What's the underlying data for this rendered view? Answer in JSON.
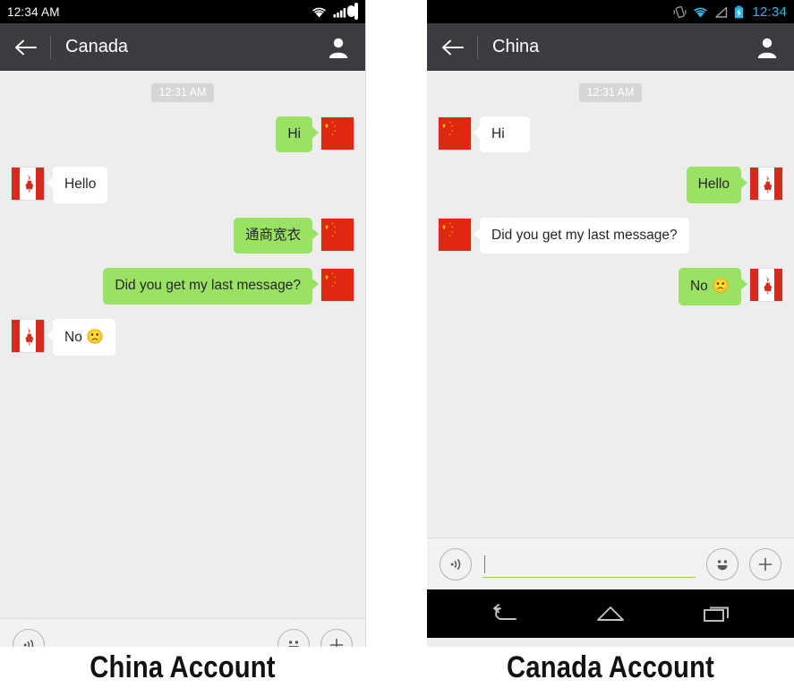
{
  "phones": [
    {
      "id": "china-account",
      "caption": "China Account",
      "statusbar": {
        "clock": "12:34 AM",
        "icons": [
          "wifi-icon",
          "signal-icon",
          "battery-icon"
        ]
      },
      "appbar": {
        "back_label": "back-arrow",
        "title": "Canada",
        "contact_label": "contact-profile"
      },
      "chat": {
        "timestamp": "12:31 AM",
        "messages": [
          {
            "side": "out",
            "text": "Hi",
            "flag": "cn"
          },
          {
            "side": "in",
            "text": "Hello",
            "flag": "ca"
          },
          {
            "side": "out",
            "text": "通商宽衣",
            "flag": "cn"
          },
          {
            "side": "out",
            "text": "Did you get my last message?",
            "flag": "cn"
          },
          {
            "side": "in",
            "text": "No ",
            "emoji": "🙁",
            "flag": "ca"
          }
        ]
      },
      "inputbar": {
        "voice_label": "voice-input",
        "value": "",
        "placeholder": "",
        "focused": false,
        "emoji_label": "emoji-picker",
        "plus_label": "more-options"
      },
      "navbar": null
    },
    {
      "id": "canada-account",
      "caption": "Canada Account",
      "statusbar": {
        "clock": "12:34",
        "icons": [
          "vibrate-icon",
          "wifi-icon",
          "signal-icon",
          "battery-charging-icon"
        ]
      },
      "appbar": {
        "back_label": "back-arrow",
        "title": "China",
        "contact_label": "contact-profile"
      },
      "chat": {
        "timestamp": "12:31 AM",
        "messages": [
          {
            "side": "in",
            "text": "Hi",
            "flag": "cn"
          },
          {
            "side": "out",
            "text": "Hello",
            "flag": "ca"
          },
          {
            "side": "in",
            "text": "Did you get my last message?",
            "flag": "cn"
          },
          {
            "side": "out",
            "text": "No ",
            "emoji": "🙁",
            "flag": "ca"
          }
        ]
      },
      "inputbar": {
        "voice_label": "voice-input",
        "value": "",
        "placeholder": "",
        "focused": true,
        "emoji_label": "emoji-picker",
        "plus_label": "more-options"
      },
      "navbar": {
        "back_label": "nav-back",
        "home_label": "nav-home",
        "recents_label": "nav-recents"
      }
    }
  ],
  "colors": {
    "appbar": "#3a3c41",
    "chat_background": "#ededed",
    "outgoing_bubble": "#9ae264",
    "incoming_bubble": "#ffffff",
    "status_accent": "#33b5e5",
    "input_focus_underline": "#8fd14f",
    "flag_red": "#de2910",
    "flag_star": "#ffde00",
    "canada_red": "#d52b1e"
  }
}
